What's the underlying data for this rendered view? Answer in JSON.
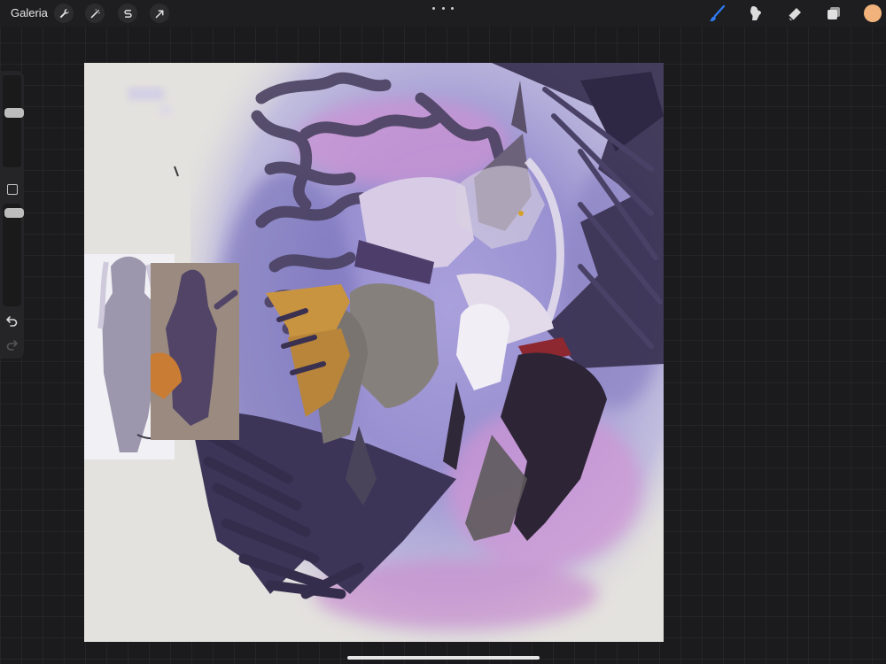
{
  "topbar": {
    "gallery_label": "Galeria",
    "left_tools": [
      {
        "name": "actions",
        "icon": "wrench-icon"
      },
      {
        "name": "adjustments",
        "icon": "magic-wand-icon"
      },
      {
        "name": "selection",
        "icon": "selection-s-icon"
      },
      {
        "name": "transform",
        "icon": "arrow-cursor-icon"
      }
    ],
    "more_icon": "ellipsis-icon",
    "right_tools": [
      {
        "name": "brush",
        "icon": "brush-icon",
        "active": true
      },
      {
        "name": "smudge",
        "icon": "smudge-icon"
      },
      {
        "name": "eraser",
        "icon": "eraser-icon"
      },
      {
        "name": "layers",
        "icon": "layers-icon"
      }
    ],
    "current_color": "#f1b37b",
    "active_color": "#2f7cf6"
  },
  "sidebar": {
    "brush_size_level": 0.6,
    "opacity_level": 0.95,
    "modify_icon": "square-icon",
    "undo_icon": "undo-icon",
    "redo_icon": "redo-icon"
  },
  "canvas": {
    "description_icon": "artwork-canvas",
    "background_color": "#e4e2de",
    "accent_colors": {
      "wing": "#3b3453",
      "shadow": "#8c84c2",
      "pink": "#c98fce",
      "cloth_gold": "#c99440",
      "shirt": "#d9cde6",
      "sash_red": "#8d2730"
    }
  }
}
